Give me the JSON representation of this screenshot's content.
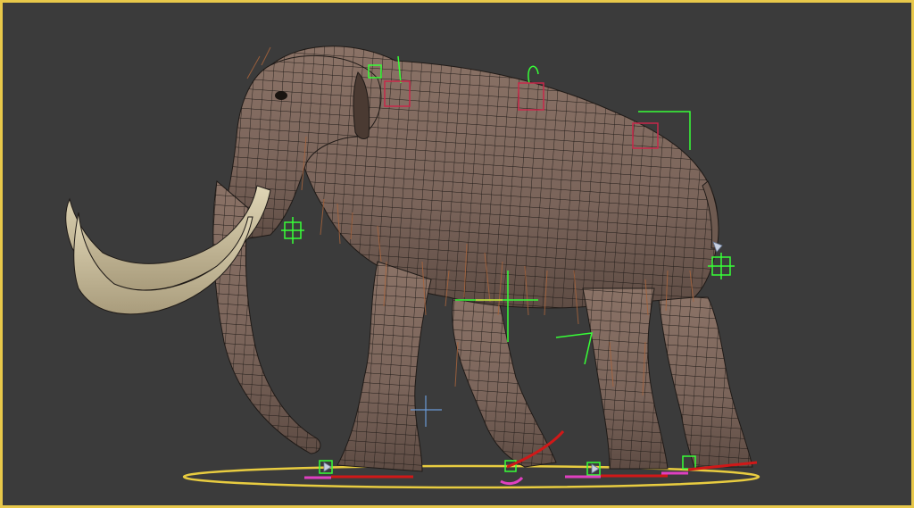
{
  "viewport": {
    "border_color": "#e8c84a",
    "background_color": "#3b3b3b"
  },
  "model": {
    "body_color": "#7a645a",
    "body_shade": "#5e4c44",
    "wire_color": "#1f1a17",
    "tusk_color": "#cfc3a0",
    "fur_color": "#a8643c"
  },
  "rig": {
    "control_green": "#37ff37",
    "control_red": "#c8284a",
    "ground_ring": "#e8cc40",
    "foot_marker_red": "#d01818",
    "foot_marker_pink": "#e040c0",
    "manipulator_blue": "#6a9ad6",
    "manipulator_yellow": "#e8e040"
  }
}
